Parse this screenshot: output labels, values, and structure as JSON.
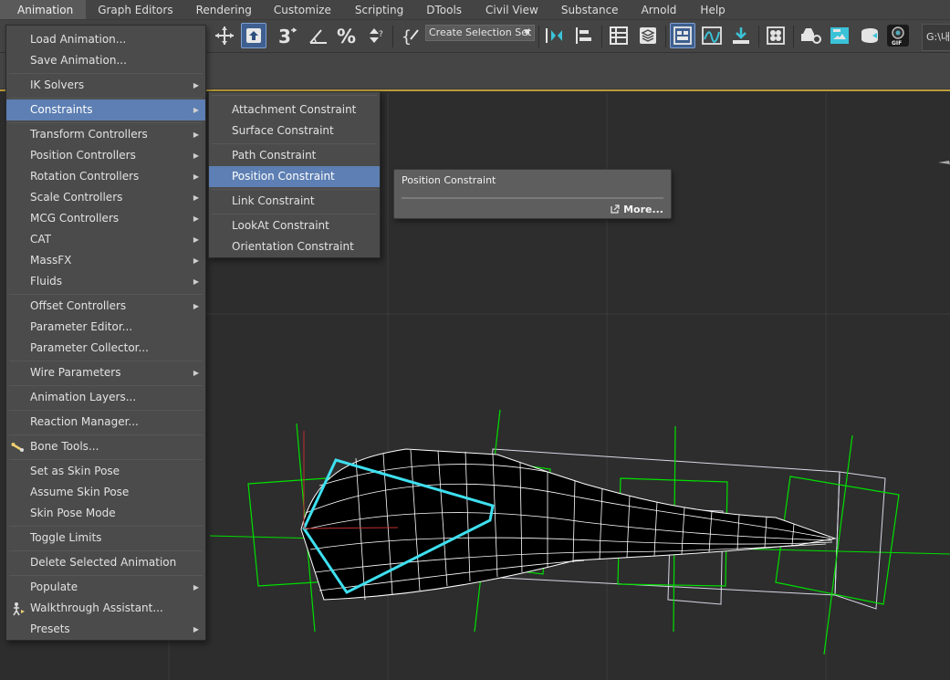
{
  "menubar": {
    "items": [
      "Animation",
      "Graph Editors",
      "Rendering",
      "Customize",
      "Scripting",
      "DTools",
      "Civil View",
      "Substance",
      "Arnold",
      "Help"
    ],
    "active": "Animation"
  },
  "toolbar": {
    "selection_set": "Create Selection Set",
    "path_field": "G:\\내",
    "icons": [
      "move-icon",
      "select-and-place-icon",
      "snaps-3d-icon",
      "angle-snap-icon",
      "percent-snap-icon",
      "spinner-snap-icon",
      "edit-named-selections-icon",
      "mirror-icon",
      "align-icon",
      "scene-explorer-icon",
      "layer-explorer-icon",
      "toggle-ribbon-icon",
      "curve-editor-icon",
      "schematic-view-icon",
      "material-editor-icon",
      "render-setup-icon",
      "rendered-frame-window-icon",
      "render-production-icon",
      "gif-recorder-icon"
    ]
  },
  "animation_menu": {
    "items": [
      {
        "label": "Load Animation...",
        "submenu": false
      },
      {
        "label": "Save Animation...",
        "submenu": false
      },
      {
        "label": "IK Solvers",
        "submenu": true
      },
      {
        "label": "Constraints",
        "submenu": true,
        "highlighted": true
      },
      {
        "label": "Transform Controllers",
        "submenu": true
      },
      {
        "label": "Position Controllers",
        "submenu": true
      },
      {
        "label": "Rotation Controllers",
        "submenu": true
      },
      {
        "label": "Scale Controllers",
        "submenu": true
      },
      {
        "label": "MCG Controllers",
        "submenu": true
      },
      {
        "label": "CAT",
        "submenu": true
      },
      {
        "label": "MassFX",
        "submenu": true
      },
      {
        "label": "Fluids",
        "submenu": true
      },
      {
        "label": "Offset Controllers",
        "submenu": true
      },
      {
        "label": "Parameter Editor...",
        "submenu": false
      },
      {
        "label": "Parameter Collector...",
        "submenu": false
      },
      {
        "label": "Wire Parameters",
        "submenu": true
      },
      {
        "label": "Animation Layers...",
        "submenu": false
      },
      {
        "label": "Reaction Manager...",
        "submenu": false
      },
      {
        "label": "Bone Tools...",
        "submenu": false,
        "icon": "bone-tools-icon"
      },
      {
        "label": "Set as Skin Pose",
        "submenu": false
      },
      {
        "label": "Assume Skin Pose",
        "submenu": false
      },
      {
        "label": "Skin Pose Mode",
        "submenu": false
      },
      {
        "label": "Toggle Limits",
        "submenu": false
      },
      {
        "label": "Delete Selected Animation",
        "submenu": false
      },
      {
        "label": "Populate",
        "submenu": true
      },
      {
        "label": "Walkthrough Assistant...",
        "submenu": false,
        "icon": "walkthrough-icon"
      },
      {
        "label": "Presets",
        "submenu": true
      }
    ]
  },
  "constraints_menu": {
    "items": [
      {
        "label": "Attachment Constraint"
      },
      {
        "label": "Surface Constraint"
      },
      {
        "label": "Path Constraint"
      },
      {
        "label": "Position Constraint",
        "highlighted": true
      },
      {
        "label": "Link Constraint"
      },
      {
        "label": "LookAt Constraint"
      },
      {
        "label": "Orientation Constraint"
      }
    ]
  },
  "tooltip": {
    "title": "Position Constraint",
    "more_label": "More..."
  },
  "colors": {
    "menu_bg": "#4b4b4b",
    "highlight": "#5d7fb3",
    "viewport_bg": "#2d2d2d",
    "viewport_border": "#b89a3a",
    "wire_white": "#ffffff",
    "wire_green": "#00e000",
    "wire_cyan": "#3ee0f0"
  }
}
